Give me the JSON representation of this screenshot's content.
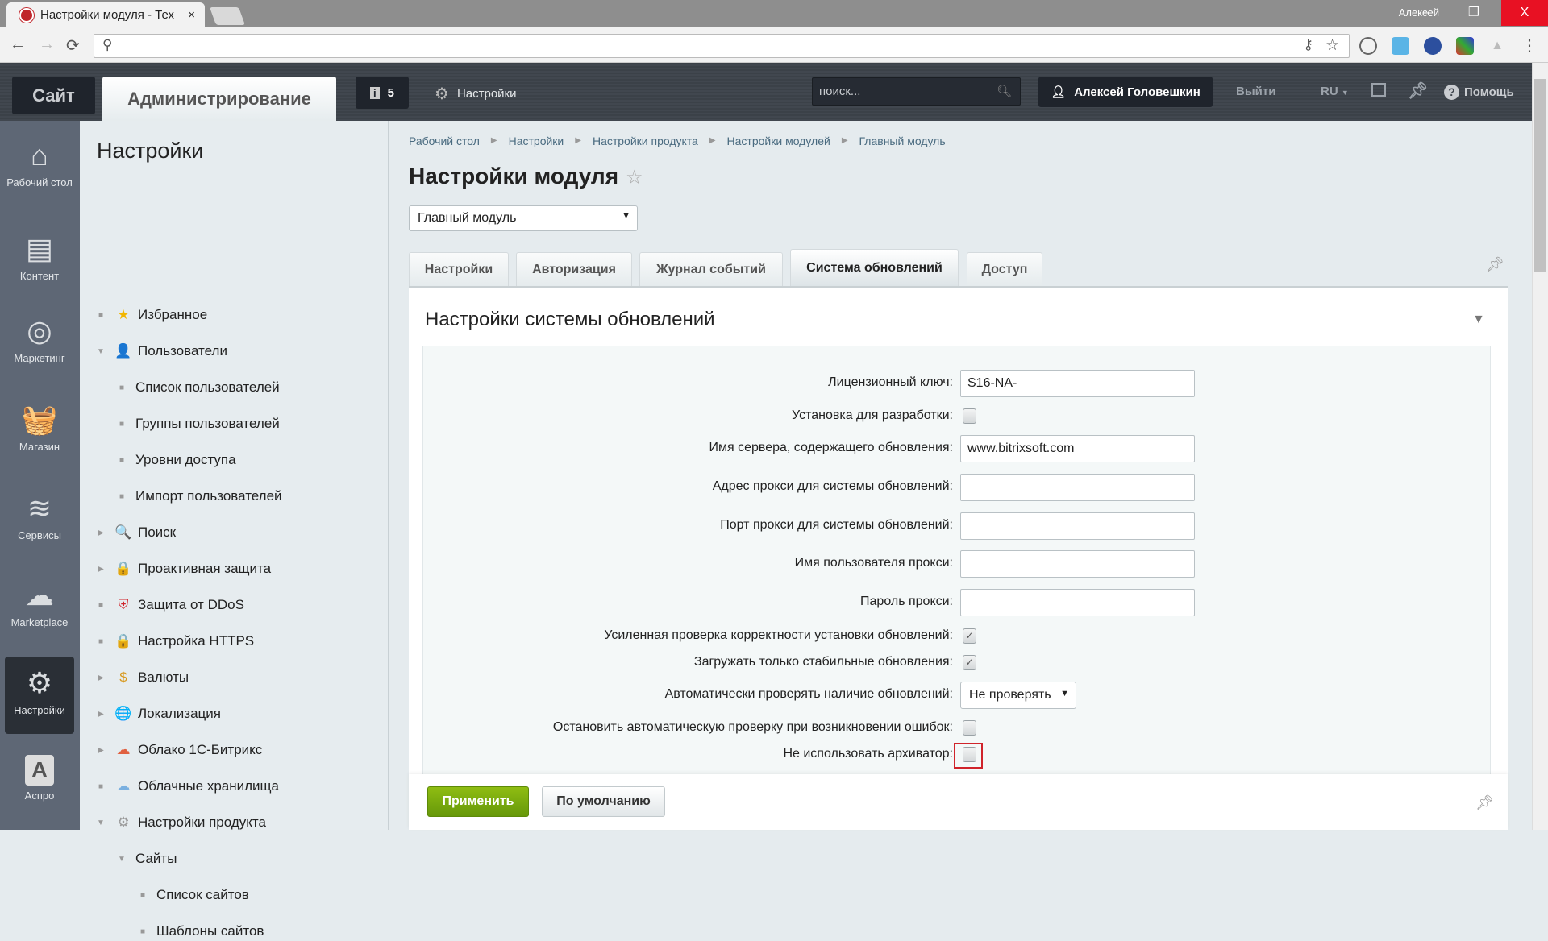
{
  "browser": {
    "tab_title": "Настройки модуля - Тех",
    "tab_close": "×",
    "window_user": "Алексей",
    "minimize": "–",
    "restore": "❐",
    "close": "X",
    "back": "←",
    "forward": "→",
    "reload": "⟳",
    "search_icon": "⚲",
    "key_icon": "⚷",
    "star_icon": "☆",
    "menu_icon": "⋮"
  },
  "header": {
    "site": "Сайт",
    "admin": "Администрирование",
    "notifications": "5",
    "settings": "Настройки",
    "search_placeholder": "поиск...",
    "user": "Алексей Головешкин",
    "logout": "Выйти",
    "lang": "RU",
    "help": "Помощь"
  },
  "iconbar": [
    {
      "label": "Рабочий стол",
      "icon": "home-icon",
      "glyph": "⌂"
    },
    {
      "label": "Контент",
      "icon": "document-icon",
      "glyph": "▤"
    },
    {
      "label": "Маркетинг",
      "icon": "target-icon",
      "glyph": "◎"
    },
    {
      "label": "Магазин",
      "icon": "basket-icon",
      "glyph": "🧺"
    },
    {
      "label": "Сервисы",
      "icon": "layers-icon",
      "glyph": "≋"
    },
    {
      "label": "Marketplace",
      "icon": "cloud-download-icon",
      "glyph": "☁"
    },
    {
      "label": "Настройки",
      "icon": "gear-icon",
      "glyph": "⚙",
      "active": true
    },
    {
      "label": "Аспро",
      "icon": "aspro-icon",
      "glyph": "A"
    }
  ],
  "menu": {
    "title": "Настройки",
    "items": [
      {
        "label": "Избранное",
        "level": 0,
        "marker": "bullet",
        "icon": "star-icon",
        "glyph": "★",
        "color": "#f2b600"
      },
      {
        "label": "Пользователи",
        "level": 0,
        "marker": "expanded",
        "icon": "user-icon",
        "glyph": "👤",
        "color": "#888"
      },
      {
        "label": "Список пользователей",
        "level": 1,
        "marker": "bullet"
      },
      {
        "label": "Группы пользователей",
        "level": 1,
        "marker": "bullet"
      },
      {
        "label": "Уровни доступа",
        "level": 1,
        "marker": "bullet"
      },
      {
        "label": "Импорт пользователей",
        "level": 1,
        "marker": "bullet"
      },
      {
        "label": "Поиск",
        "level": 0,
        "marker": "collapsed",
        "icon": "magnifier-icon",
        "glyph": "🔍",
        "color": "#6a8bb0"
      },
      {
        "label": "Проактивная защита",
        "level": 0,
        "marker": "collapsed",
        "icon": "lock-icon",
        "glyph": "🔒",
        "color": "#e5b400"
      },
      {
        "label": "Защита от DDoS",
        "level": 0,
        "marker": "bullet",
        "icon": "shield-icon",
        "glyph": "⛨",
        "color": "#d0242b"
      },
      {
        "label": "Настройка HTTPS",
        "level": 0,
        "marker": "bullet",
        "icon": "https-lock-icon",
        "glyph": "🔒",
        "color": "#1a7fd4"
      },
      {
        "label": "Валюты",
        "level": 0,
        "marker": "collapsed",
        "icon": "coin-icon",
        "glyph": "$",
        "color": "#d89a20"
      },
      {
        "label": "Локализация",
        "level": 0,
        "marker": "collapsed",
        "icon": "globe-icon",
        "glyph": "🌐",
        "color": "#3a7fc0"
      },
      {
        "label": "Облако 1С-Битрикс",
        "level": 0,
        "marker": "collapsed",
        "icon": "bitrix-cloud-icon",
        "glyph": "☁",
        "color": "#e06040"
      },
      {
        "label": "Облачные хранилища",
        "level": 0,
        "marker": "bullet",
        "icon": "cloud-storage-icon",
        "glyph": "☁",
        "color": "#7ab0e0"
      },
      {
        "label": "Настройки продукта",
        "level": 0,
        "marker": "expanded",
        "icon": "gear-icon",
        "glyph": "⚙",
        "color": "#999"
      },
      {
        "label": "Сайты",
        "level": 1,
        "marker": "expanded"
      },
      {
        "label": "Список сайтов",
        "level": 2,
        "marker": "bullet"
      },
      {
        "label": "Шаблоны сайтов",
        "level": 2,
        "marker": "bullet"
      }
    ]
  },
  "breadcrumbs": [
    "Рабочий стол",
    "Настройки",
    "Настройки продукта",
    "Настройки модулей",
    "Главный модуль"
  ],
  "page_title": "Настройки модуля",
  "module_select": "Главный модуль",
  "tabs": [
    {
      "label": "Настройки"
    },
    {
      "label": "Авторизация"
    },
    {
      "label": "Журнал событий"
    },
    {
      "label": "Система обновлений",
      "active": true
    },
    {
      "label": "Доступ"
    }
  ],
  "panel_title": "Настройки системы обновлений",
  "form": [
    {
      "label": "Лицензионный ключ:",
      "type": "text",
      "value": "S16-NA-"
    },
    {
      "label": "Установка для разработки:",
      "type": "checkbox",
      "checked": false
    },
    {
      "label": "Имя сервера, содержащего обновления:",
      "type": "text",
      "value": "www.bitrixsoft.com"
    },
    {
      "label": "Адрес прокси для системы обновлений:",
      "type": "text",
      "value": ""
    },
    {
      "label": "Порт прокси для системы обновлений:",
      "type": "text",
      "value": ""
    },
    {
      "label": "Имя пользователя прокси:",
      "type": "text",
      "value": ""
    },
    {
      "label": "Пароль прокси:",
      "type": "text",
      "value": ""
    },
    {
      "label": "Усиленная проверка корректности установки обновлений:",
      "type": "checkbox",
      "checked": true
    },
    {
      "label": "Загружать только стабильные обновления:",
      "type": "checkbox",
      "checked": true
    },
    {
      "label": "Автоматически проверять наличие обновлений:",
      "type": "select",
      "value": "Не проверять"
    },
    {
      "label": "Остановить автоматическую проверку при возникновении ошибок:",
      "type": "checkbox",
      "checked": false
    },
    {
      "label": "Не использовать архиватор:",
      "type": "checkbox",
      "checked": false,
      "highlighted": true
    }
  ],
  "buttons": {
    "apply": "Применить",
    "default": "По умолчанию"
  },
  "colors": {
    "apply": "#7aaa0e",
    "highlight": "#d0242b",
    "header": "#3e444c",
    "iconbar": "#5e6775"
  }
}
